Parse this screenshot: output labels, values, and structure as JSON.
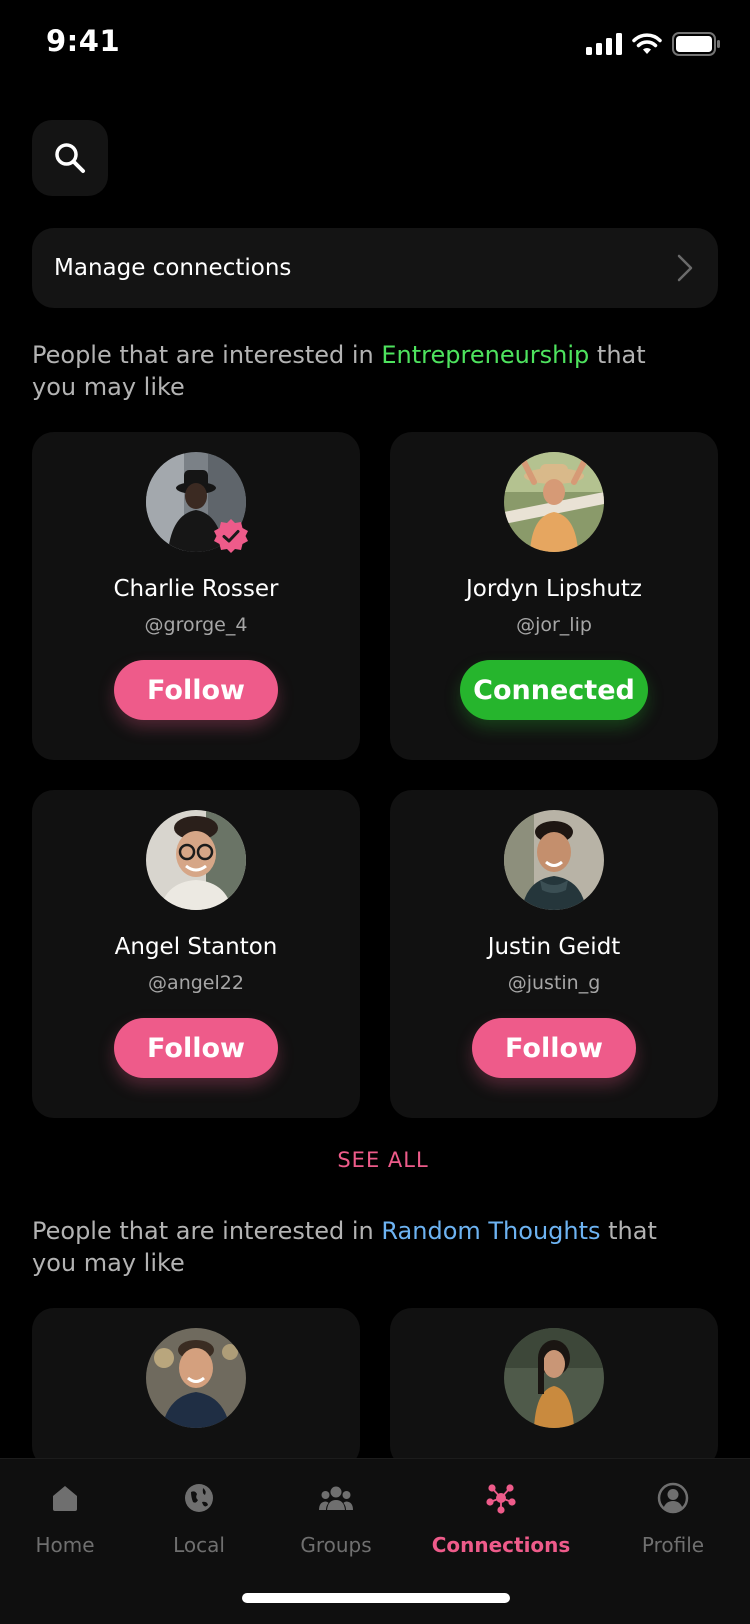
{
  "status": {
    "time": "9:41"
  },
  "search": {
    "icon": "search-icon"
  },
  "manage": {
    "label": "Manage connections"
  },
  "section1": {
    "prefix": "People that are interested in ",
    "interest": "Entrepreneurship",
    "suffix": " that you may like",
    "accent": "#4ee35e"
  },
  "section2": {
    "prefix": "People that are interested in ",
    "interest": "Random Thoughts",
    "suffix": " that you may like",
    "accent": "#6db3f2"
  },
  "cards": [
    {
      "name": "Charlie Rosser",
      "handle": "@grorge_4",
      "button": "Follow",
      "verified": true
    },
    {
      "name": "Jordyn Lipshutz",
      "handle": "@jor_lip",
      "button": "Connected",
      "verified": false
    },
    {
      "name": "Angel Stanton",
      "handle": "@angel22",
      "button": "Follow",
      "verified": false
    },
    {
      "name": "Justin Geidt",
      "handle": "@justin_g",
      "button": "Follow",
      "verified": false
    }
  ],
  "see_all": "SEE ALL",
  "tabs": [
    {
      "label": "Home",
      "icon": "home-icon"
    },
    {
      "label": "Local",
      "icon": "globe-icon"
    },
    {
      "label": "Groups",
      "icon": "groups-icon"
    },
    {
      "label": "Connections",
      "icon": "connections-icon",
      "active": true
    },
    {
      "label": "Profile",
      "icon": "profile-icon"
    }
  ],
  "colors": {
    "accent_pink": "#ee5b8a",
    "connected_green": "#26b52d",
    "background": "#000000",
    "card": "#111111"
  }
}
